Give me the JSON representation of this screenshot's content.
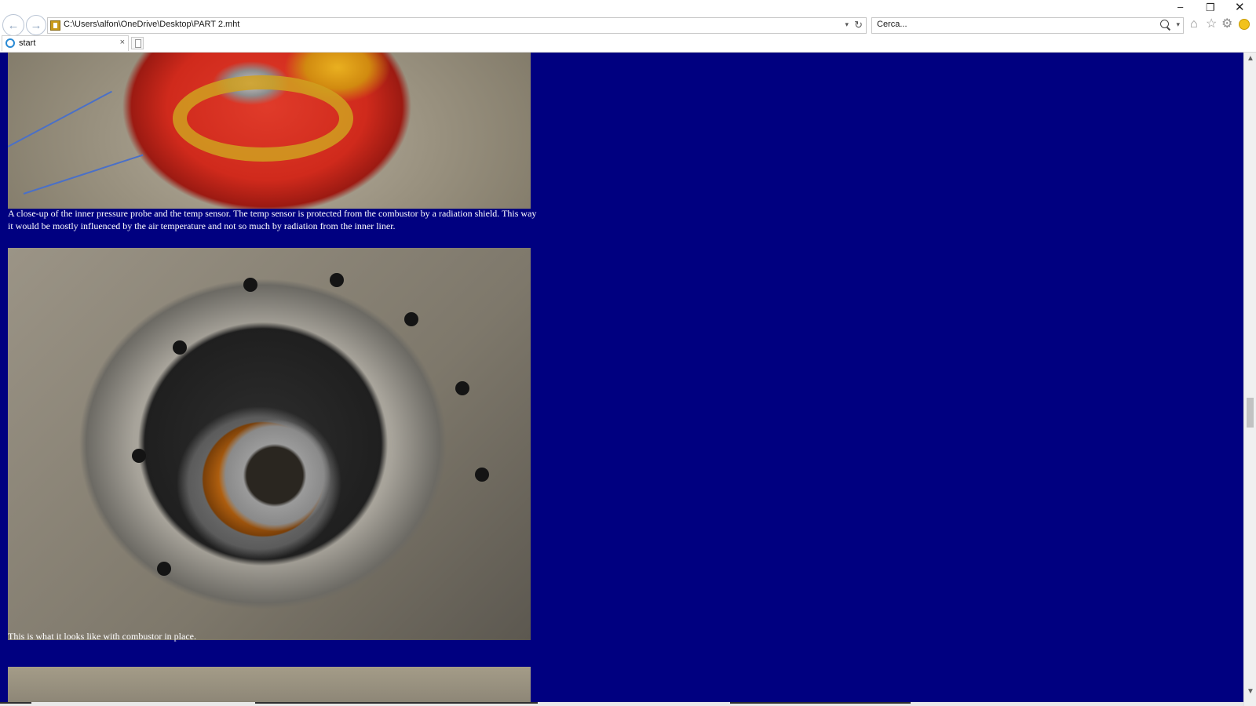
{
  "browser": {
    "address": "C:\\Users\\alfon\\OneDrive\\Desktop\\PART 2.mht",
    "search_placeholder": "Cerca...",
    "tab": {
      "label": "start",
      "close_glyph": "×"
    },
    "window_controls": {
      "minimize": "–",
      "restore": "❐",
      "close": "✕"
    },
    "nav": {
      "back_glyph": "←",
      "forward_glyph": "→",
      "dropdown_glyph": "▾",
      "refresh_glyph": "↻"
    },
    "toolbar_icons": [
      "home-icon",
      "star-icon",
      "gear-icon",
      "smiley-icon"
    ]
  },
  "page": {
    "background_color": "#000080",
    "text_color": "#ffffff",
    "captions": [
      "A close-up of the inner pressure probe and the temp sensor. The temp sensor is protected from the combustor by a radiation shield. This way it would be mostly influenced by the air temperature and not so much by radiation from the inner liner.",
      "This is what it looks like with combustor in place."
    ],
    "photos": [
      "photo-inner-pressure-probe-and-temp-sensor",
      "photo-combustor-in-place",
      "photo-next-partial"
    ]
  },
  "scrollbar": {
    "up_glyph": "▲",
    "down_glyph": "▼"
  }
}
